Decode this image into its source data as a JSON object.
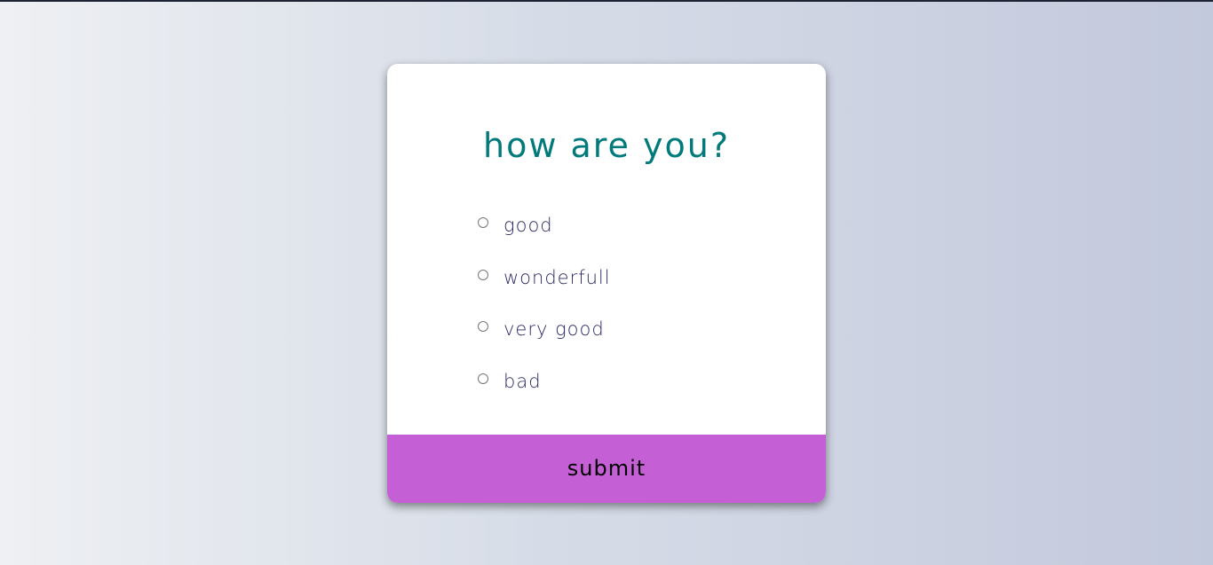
{
  "colors": {
    "title": "#007a7a",
    "answer_text": "#2b2a63",
    "submit_bg": "#c55fd5",
    "submit_text": "#000000"
  },
  "quiz": {
    "question": "how are you?",
    "answers": [
      {
        "label": "good"
      },
      {
        "label": "wonderfull"
      },
      {
        "label": "very good"
      },
      {
        "label": "bad"
      }
    ],
    "submit_label": "submit"
  }
}
